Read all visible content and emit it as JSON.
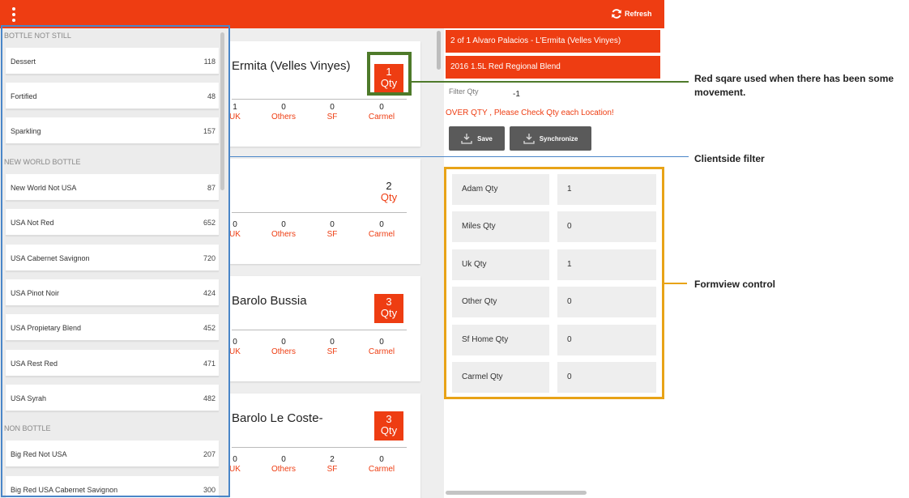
{
  "topbar": {
    "refresh_label": "Refresh"
  },
  "sidebar": {
    "sections": [
      {
        "header": "BOTTLE NOT STILL",
        "items": [
          {
            "name": "Dessert",
            "count": "118"
          },
          {
            "name": "Fortified",
            "count": "48"
          },
          {
            "name": "Sparkling",
            "count": "157"
          }
        ]
      },
      {
        "header": "NEW WORLD BOTTLE",
        "items": [
          {
            "name": "New World Not USA",
            "count": "87"
          },
          {
            "name": "USA Not Red",
            "count": "652"
          },
          {
            "name": "USA Cabernet Savignon",
            "count": "720"
          },
          {
            "name": "USA Pinot Noir",
            "count": "424"
          },
          {
            "name": "USA Propietary Blend",
            "count": "452"
          },
          {
            "name": "USA Rest Red",
            "count": "471"
          },
          {
            "name": "USA Syrah",
            "count": "482"
          }
        ]
      },
      {
        "header": "NON BOTTLE",
        "items": [
          {
            "name": "Big Red Not USA",
            "count": "207"
          },
          {
            "name": "Big Red USA Cabernet Savignon",
            "count": "300"
          }
        ]
      }
    ]
  },
  "cards": [
    {
      "title": "Ermita (Velles Vinyes)",
      "qty": "1",
      "qty_label": "Qty",
      "highlight": true,
      "locations": [
        {
          "value": "1",
          "label": "UK"
        },
        {
          "value": "0",
          "label": "Others"
        },
        {
          "value": "0",
          "label": "SF"
        },
        {
          "value": "0",
          "label": "Carmel"
        }
      ]
    },
    {
      "title": "",
      "qty": "2",
      "qty_label": "Qty",
      "highlight": false,
      "locations": [
        {
          "value": "0",
          "label": "UK"
        },
        {
          "value": "0",
          "label": "Others"
        },
        {
          "value": "0",
          "label": "SF"
        },
        {
          "value": "0",
          "label": "Carmel"
        }
      ]
    },
    {
      "title": "Barolo Bussia",
      "qty": "3",
      "qty_label": "Qty",
      "highlight": true,
      "locations": [
        {
          "value": "0",
          "label": "UK"
        },
        {
          "value": "0",
          "label": "Others"
        },
        {
          "value": "0",
          "label": "SF"
        },
        {
          "value": "0",
          "label": "Carmel"
        }
      ]
    },
    {
      "title": "Barolo Le Coste-",
      "qty": "3",
      "qty_label": "Qty",
      "highlight": true,
      "locations": [
        {
          "value": "0",
          "label": "UK"
        },
        {
          "value": "0",
          "label": "Others"
        },
        {
          "value": "2",
          "label": "SF"
        },
        {
          "value": "0",
          "label": "Carmel"
        }
      ]
    }
  ],
  "detail": {
    "header_line1": "2   of   1     Alvaro Palacios - L'Ermita (Velles Vinyes)",
    "header_line2": "2016     1.5L     Red     Regional Blend",
    "filter_label": "Filter Qty",
    "filter_value": "-1",
    "warning": "OVER QTY , Please Check Qty each Location!",
    "save_label": "Save",
    "sync_label": "Synchronize",
    "form": [
      {
        "label": "Adam Qty",
        "value": "1"
      },
      {
        "label": "Miles Qty",
        "value": "0"
      },
      {
        "label": "Uk Qty",
        "value": "1"
      },
      {
        "label": "Other Qty",
        "value": "0"
      },
      {
        "label": "Sf Home Qty",
        "value": "0"
      },
      {
        "label": "Carmel Qty",
        "value": "0"
      }
    ]
  },
  "annotations": {
    "red_square": "Red sqare used when there has been some movement.",
    "client_filter": "Clientside filter",
    "formview": "Formview control"
  },
  "colors": {
    "accent": "#ee3d12",
    "blue_box": "#4a86c8",
    "green_box": "#4e7a2a",
    "orange_box": "#e8a317"
  }
}
